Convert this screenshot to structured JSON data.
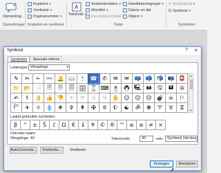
{
  "ribbon": {
    "groups": [
      "Opmerkingen",
      "Koptekst en voettekst",
      "Tekst",
      "Symbolen"
    ],
    "comment_label": "Opmerking",
    "header_items": [
      "Koptekst",
      "Voettekst",
      "Paginanummer"
    ],
    "textbox_label": "Tekstvak",
    "text_items": [
      "Snelonderdelen",
      "WordArt",
      "Decoraties initiaal"
    ],
    "text_items2": [
      "Handtekeningregel",
      "Datum en tijd",
      "Object"
    ],
    "symbol_items": [
      "Vergelijking",
      "Symbool"
    ]
  },
  "dialog": {
    "title": "Symbool",
    "tabs": [
      "Symbolen",
      "Speciale tekens"
    ],
    "font_label": "Lettertype:",
    "font_value": "Wingdings",
    "symbols": [
      "✎",
      "✂",
      "✁",
      "👓",
      "🔔",
      "📖",
      "🕯",
      "☎",
      "✆",
      "✉",
      "✉",
      "📪",
      "📫",
      "📬",
      "📭",
      "📮",
      "📁",
      "📂",
      "📄",
      "🗎",
      "🗏",
      "🗐",
      "🗄",
      "⌛",
      "⌨",
      "🖰",
      "🖲",
      "🖳",
      "🖴",
      "🖫",
      "🖬",
      "✇",
      "✍",
      "✌",
      "👌",
      "👍",
      "👎",
      "☜",
      "☞",
      "☝",
      "☟",
      "✋",
      "☺",
      "😐",
      "☹",
      "💣",
      "☠",
      "⚐",
      "🏱",
      "✈",
      "☼",
      "💧",
      "❄",
      "✞",
      "✟",
      "✠",
      "✡",
      "☪",
      "☯",
      "ॐ",
      "☸",
      "♈",
      "♉",
      "♊"
    ],
    "selected_index": 7,
    "recent_label": "Laatst gebruikte symbolen:",
    "recent": [
      "β",
      "°",
      "±",
      "Š",
      "ć",
      "Ω",
      "€",
      "£",
      "¥",
      "©",
      "®",
      "™",
      "≤",
      "≥",
      "≠",
      "×"
    ],
    "unicode_name_label": "Unicode-naam:",
    "unicode_name_value": "Wingdings: 40",
    "char_code_label": "Tekencode:",
    "char_code_value": "40",
    "from_label": "van:",
    "from_value": "Symbool (decimaal)",
    "autocorrect_button": "AutoCorrectie...",
    "shortcut_button": "Sneltoets...",
    "shortcut_label": "Sneltoets:",
    "insert_button": "Invoegen",
    "cancel_button": "Annuleren"
  }
}
